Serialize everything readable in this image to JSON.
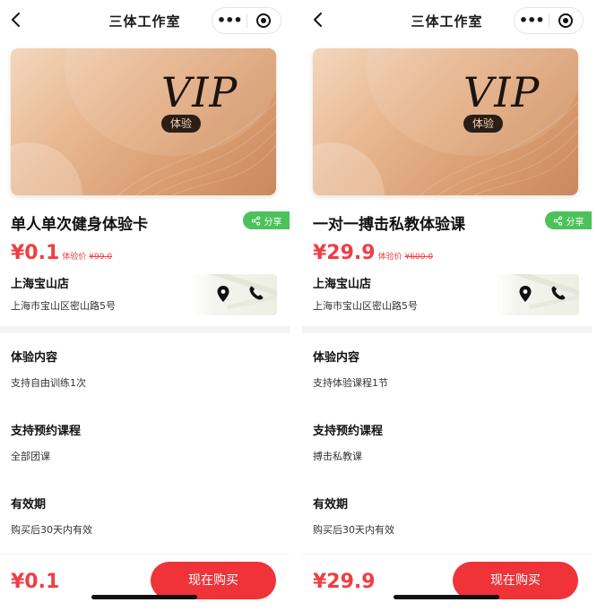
{
  "nav": {
    "title": "三体工作室",
    "more_label": "•••"
  },
  "colors": {
    "price_red": "#ef3e42",
    "button_red": "#ef3338",
    "share_green": "#4cc25a",
    "card_gold": "#e8b791"
  },
  "icons": {
    "back": "chevron-left-icon",
    "more": "more-dots-icon",
    "close": "target-circle-icon",
    "share": "share-icon",
    "location": "location-pin-icon",
    "phone": "phone-icon"
  },
  "screens": [
    {
      "card": {
        "vip_text": "VIP",
        "badge": "体验"
      },
      "title": "单人单次健身体验卡",
      "share_label": "分享",
      "price": {
        "main": "¥0.1",
        "label": "体验价",
        "original": "¥99.0"
      },
      "store": {
        "name": "上海宝山店",
        "address": "上海市宝山区密山路5号"
      },
      "sections": [
        {
          "title": "体验内容",
          "text": "支持自由训练1次"
        },
        {
          "title": "支持预约课程",
          "text": "全部团课"
        },
        {
          "title": "有效期",
          "text": "购买后30天内有效"
        }
      ],
      "bottom": {
        "price": "¥0.1",
        "buy_label": "现在购买"
      }
    },
    {
      "card": {
        "vip_text": "VIP",
        "badge": "体验"
      },
      "title": "一对一搏击私教体验课",
      "share_label": "分享",
      "price": {
        "main": "¥29.9",
        "label": "体验价",
        "original": "¥600.0"
      },
      "store": {
        "name": "上海宝山店",
        "address": "上海市宝山区密山路5号"
      },
      "sections": [
        {
          "title": "体验内容",
          "text": "支持体验课程1节"
        },
        {
          "title": "支持预约课程",
          "text": "搏击私教课"
        },
        {
          "title": "有效期",
          "text": "购买后30天内有效"
        }
      ],
      "bottom": {
        "price": "¥29.9",
        "buy_label": "现在购买"
      }
    }
  ]
}
